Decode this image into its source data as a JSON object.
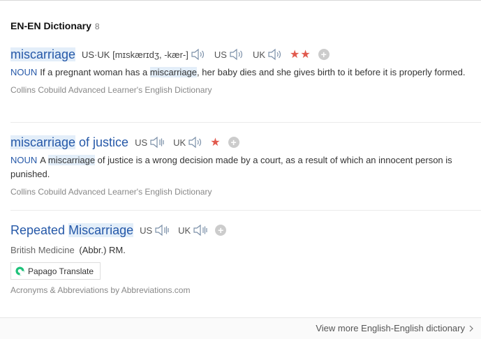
{
  "header": {
    "title": "EN-EN Dictionary",
    "count": "8"
  },
  "entries": [
    {
      "word_hl": "miscarriage",
      "word_rest": "",
      "pron": "US·UK [mɪskærɪdʒ, -kær-]",
      "regions": [
        "US",
        "UK"
      ],
      "stars": "★★",
      "pos": "NOUN",
      "def_before": "If a pregnant woman has a ",
      "def_hl": "miscarriage",
      "def_after": ", her baby dies and she gives birth to it before it is properly formed.",
      "source": "Collins Cobuild Advanced Learner's English Dictionary"
    },
    {
      "word_hl": "miscarriage",
      "word_rest": " of justice",
      "regions": [
        "US",
        "UK"
      ],
      "stars": "★",
      "pos": "NOUN",
      "def_before": "A ",
      "def_hl": "miscarriage",
      "def_after": " of justice is a wrong decision made by a court, as a result of which an innocent person is punished.",
      "source": "Collins Cobuild Advanced Learner's English Dictionary"
    },
    {
      "word_pre": "Repeated ",
      "word_hl": "Miscarriage",
      "regions": [
        "US",
        "UK"
      ],
      "category": "British Medicine",
      "abbr": "(Abbr.) RM.",
      "papago": "Papago Translate",
      "source": "Acronyms & Abbreviations by Abbreviations.com"
    }
  ],
  "footer": {
    "more": "View more English-English dictionary"
  },
  "colors": {
    "link": "#2558a8",
    "star": "#e15a4e",
    "highlight": "#e3eef9"
  },
  "icons": {
    "speaker": "speaker-icon",
    "plus": "add-wordbook-icon",
    "papago": "papago-logo-icon",
    "chevron": "chevron-right-icon"
  }
}
